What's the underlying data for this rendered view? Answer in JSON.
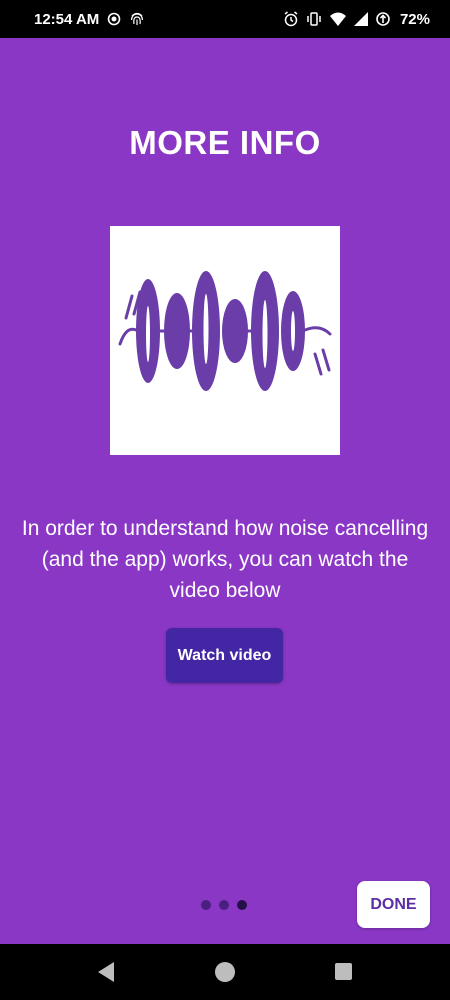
{
  "status_bar": {
    "time": "12:54 AM",
    "battery": "72%",
    "icons": [
      "record-icon",
      "fingerprint-icon",
      "alarm-icon",
      "vibrate-icon",
      "wifi-icon",
      "signal-icon",
      "data-saver-icon"
    ]
  },
  "screen": {
    "title": "MORE INFO",
    "description": "In order to understand how noise cancelling (and the app) works, you can watch the video below",
    "watch_button": "Watch video",
    "done_button": "DONE",
    "page_indicator": {
      "total": 3,
      "current": 3
    }
  },
  "colors": {
    "background": "#8a37c6",
    "button": "#4326a3",
    "wave": "#6a3da8",
    "done_text": "#5b2ea5"
  },
  "nav_bar": {
    "icons": [
      "back-icon",
      "home-icon",
      "recents-icon"
    ]
  }
}
